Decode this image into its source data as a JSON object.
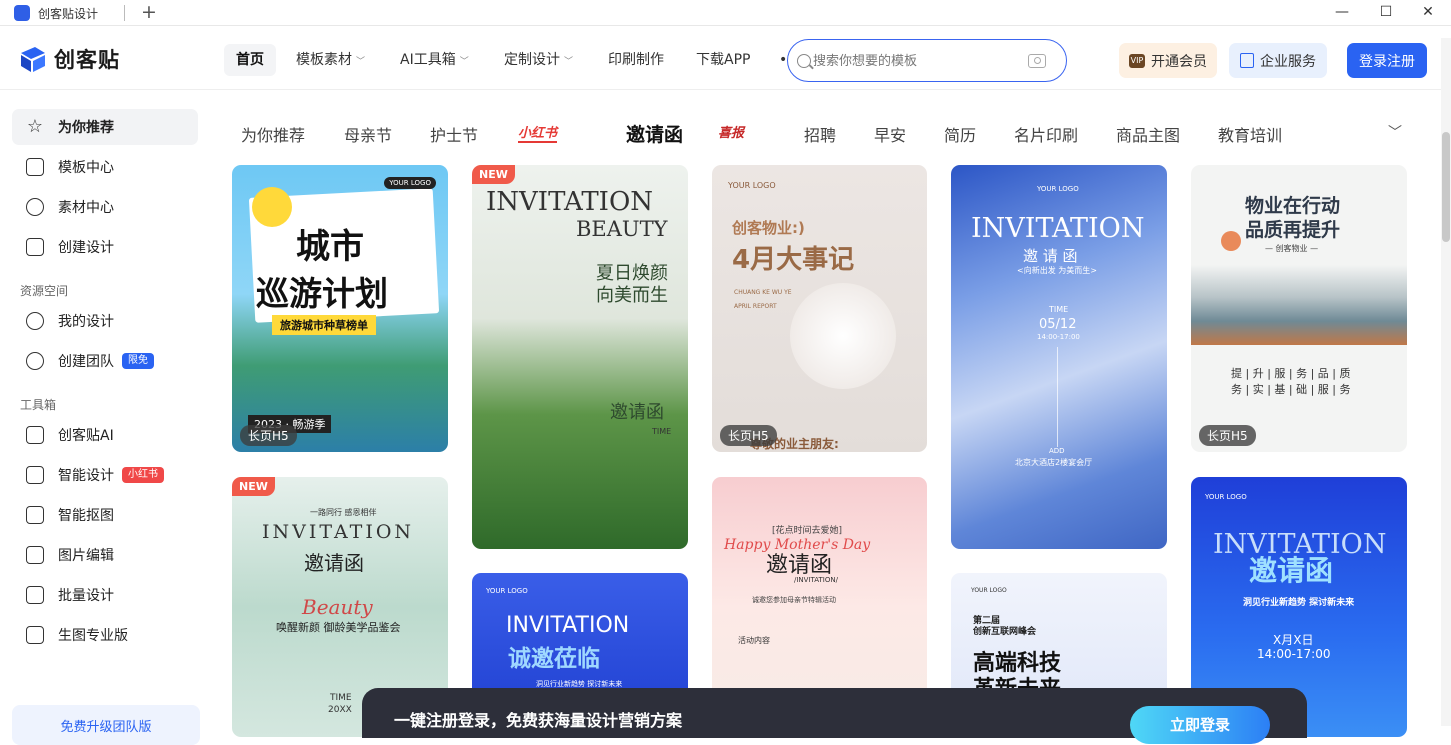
{
  "browser": {
    "tab_title": "创客贴设计",
    "new_tab_symbol": "+",
    "window_controls": {
      "minimize": "—",
      "maximize": "☐",
      "close": "✕"
    }
  },
  "header": {
    "logo_text": "创客贴",
    "nav": [
      {
        "label": "首页",
        "active": true,
        "has_chevron": false
      },
      {
        "label": "模板素材",
        "has_chevron": true
      },
      {
        "label": "AI工具箱",
        "has_chevron": true
      },
      {
        "label": "定制设计",
        "has_chevron": true
      },
      {
        "label": "印刷制作",
        "has_chevron": false
      },
      {
        "label": "下载APP",
        "has_chevron": false
      }
    ],
    "nav_dot": "•",
    "search_placeholder": "搜索你想要的模板",
    "vip_label": "开通会员",
    "vip_icon_text": "VIP",
    "enterprise_label": "企业服务",
    "login_label": "登录注册"
  },
  "sidebar": {
    "items_top": [
      {
        "label": "为你推荐",
        "icon": "star-icon",
        "active": true
      },
      {
        "label": "模板中心",
        "icon": "template-icon"
      },
      {
        "label": "素材中心",
        "icon": "material-icon"
      },
      {
        "label": "创建设计",
        "icon": "create-icon"
      }
    ],
    "group_resources": "资源空间",
    "items_resources": [
      {
        "label": "我的设计",
        "icon": "user-icon"
      },
      {
        "label": "创建团队",
        "icon": "team-icon",
        "badge": "限免"
      }
    ],
    "group_tools": "工具箱",
    "items_tools": [
      {
        "label": "创客贴AI",
        "icon": "ai-icon"
      },
      {
        "label": "智能设计",
        "icon": "smart-design-icon",
        "badge": "小红书"
      },
      {
        "label": "智能抠图",
        "icon": "cutout-icon"
      },
      {
        "label": "图片编辑",
        "icon": "crop-icon"
      },
      {
        "label": "批量设计",
        "icon": "batch-icon"
      },
      {
        "label": "生图专业版",
        "icon": "pro-icon"
      }
    ],
    "promo": "免费升级团队版"
  },
  "categories": [
    "为你推荐",
    "母亲节",
    "护士节",
    "小红书",
    "邀请函",
    "喜报",
    "招聘",
    "早安",
    "简历",
    "名片印刷",
    "商品主图",
    "教育培训"
  ],
  "cards": {
    "c1": {
      "title1": "城市",
      "title2": "巡游计划",
      "strip": "旅游城市种草榜单",
      "season": "2023 · 畅游季",
      "tag": "长页H5",
      "logo": "YOUR LOGO"
    },
    "c2": {
      "new": "NEW",
      "l1": "INVITATION",
      "l2": "BEAUTY",
      "cn1": "夏日焕颜",
      "cn2": "向美而生",
      "cn3": "邀请函",
      "time": "TIME"
    },
    "c3": {
      "logo": "YOUR LOGO",
      "l1": "创客物业:)",
      "l2": "4月大事记",
      "en": "CHUANG KE WU YE",
      "report": "APRIL REPORT",
      "bottom": "尊敬的业主朋友:",
      "tag": "长页H5"
    },
    "c4": {
      "logo": "YOUR LOGO",
      "l1": "INVITATION",
      "cn": "邀 请 函",
      "sub": "<向新出发 为美而生>",
      "time": "TIME",
      "date": "05/12",
      "hours": "14:00-17:00",
      "addr": "ADD",
      "place": "北京大酒店2楼宴会厅"
    },
    "c5": {
      "l1": "物业在行动",
      "l2": "品质再提升",
      "sub": "— 创客物业 —",
      "p1": "提 | 升 | 服 | 务 | 品 | 质",
      "p2": "务 | 实 | 基 | 础 | 服 | 务",
      "tag": "长页H5"
    },
    "c6": {
      "new": "NEW",
      "top": "一路同行 感恩相伴",
      "l1": "INVITATION",
      "cn": "邀请函",
      "script": "Beauty",
      "sub": "唤醒新颜 御龄美学品鉴会",
      "time": "TIME",
      "year": "20XX"
    },
    "c7": {
      "logo": "YOUR LOGO",
      "l1": "INVITATION",
      "cn": "诚邀莅临",
      "sub": "洞见行业新趋势 探讨新未来"
    },
    "c8": {
      "top": "[花点时间去爱她]",
      "script": "Happy Mother's Day",
      "cn": "邀请函",
      "en": "/INVITATION/",
      "sub": "诚邀您参加母亲节特辑活动",
      "sec": "活动内容"
    },
    "c9": {
      "logo": "YOUR LOGO",
      "l1": "第二届",
      "l2": "创新互联网峰会",
      "l3": "高端科技",
      "l4": "革新未来"
    },
    "c10": {
      "logo": "YOUR LOGO",
      "l1": "INVITATION",
      "cn": "邀请函",
      "sub": "洞见行业新趋势 探讨新未来",
      "date": "X月X日",
      "hours": "14:00-17:00"
    }
  },
  "banner": {
    "text": "一键注册登录，免费获海量设计营销方案",
    "button": "立即登录"
  }
}
